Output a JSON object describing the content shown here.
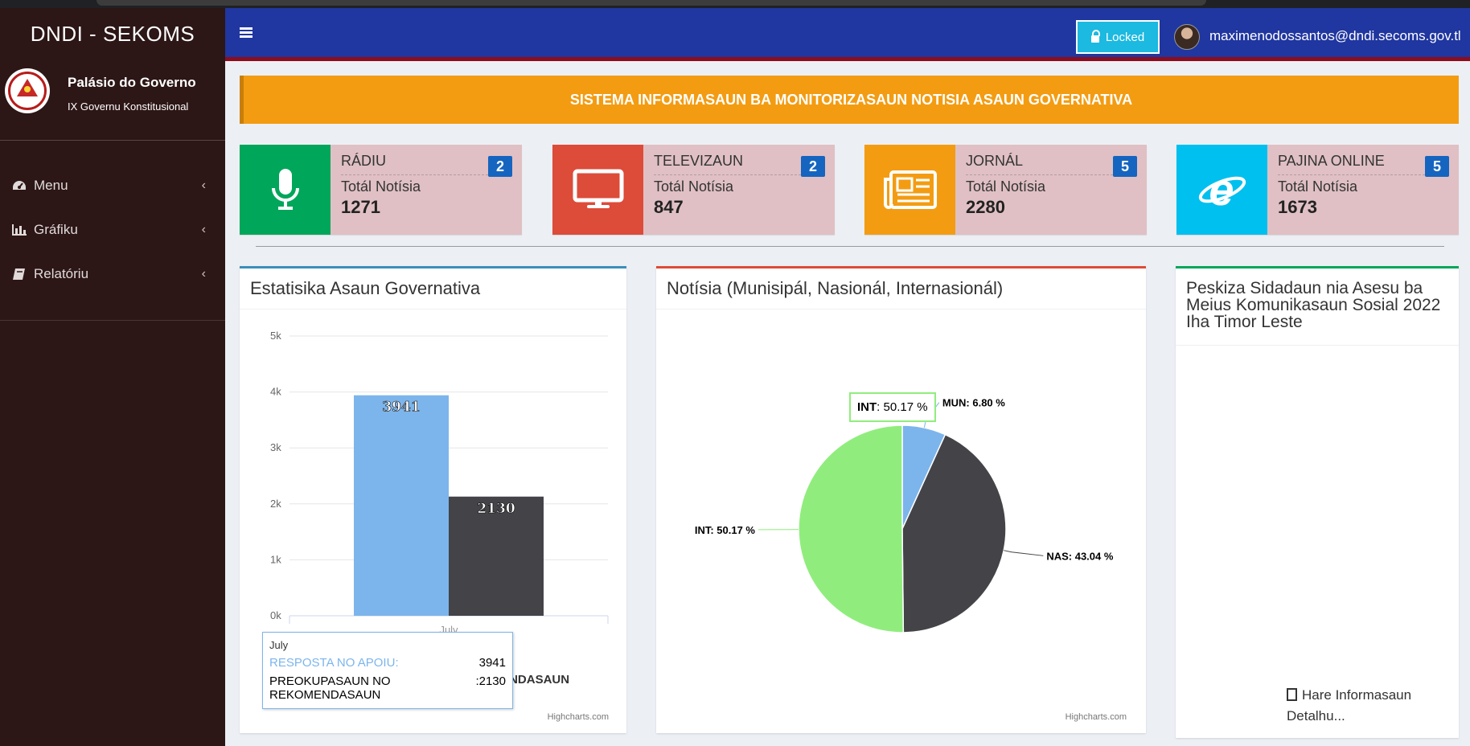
{
  "sidebar": {
    "brand": "DNDI - SEKOMS",
    "org_name": "Palásio do Governo",
    "org_sub": "IX Governu Konstitusional",
    "items": [
      {
        "label": "Menu",
        "icon": "dashboard-icon"
      },
      {
        "label": "Gráfiku",
        "icon": "bar-chart-icon"
      },
      {
        "label": "Relatóriu",
        "icon": "book-icon"
      }
    ]
  },
  "header": {
    "locked_label": "Locked",
    "email": "maximenodossantos@dndi.secoms.gov.tl"
  },
  "banner": "SISTEMA INFORMASAUN BA MONITORIZASAUN NOTISIA ASAUN GOVERNATIVA",
  "info_boxes": [
    {
      "title": "RÁDIU",
      "badge": "2",
      "label": "Totál Notísia",
      "value": "1271",
      "color": "#00a65a",
      "icon": "microphone-icon"
    },
    {
      "title": "TELEVIZAUN",
      "badge": "2",
      "label": "Totál Notísia",
      "value": "847",
      "color": "#dd4b39",
      "icon": "monitor-icon"
    },
    {
      "title": "JORNÁL",
      "badge": "5",
      "label": "Totál Notísia",
      "value": "2280",
      "color": "#f39c12",
      "icon": "newspaper-icon"
    },
    {
      "title": "PAJINA ONLINE",
      "badge": "5",
      "label": "Totál Notísia",
      "value": "1673",
      "color": "#00c0ef",
      "icon": "internet-explorer-icon"
    }
  ],
  "bar_box": {
    "title": "Estatisika Asaun Governativa",
    "credit": "Highcharts.com",
    "tooltip_header": "July"
  },
  "pie_box": {
    "title": "Notísia (Munisipál, Nasionál, Internasionál)",
    "credit": "Highcharts.com",
    "tooltip_label": "INT",
    "tooltip_value": ": 50.17 %"
  },
  "survey_box": {
    "title": "Peskiza Sidadaun nia Asesu ba Meius Komunikasaun Sosial 2022 Iha Timor Leste",
    "link_label": "Hare Informasaun Detalhu..."
  },
  "chart_data": [
    {
      "type": "bar",
      "title": "Estatisika Asaun Governativa",
      "categories": [
        "July"
      ],
      "series": [
        {
          "name": "RESPOSTA NO APOIU",
          "values": [
            3941
          ],
          "color": "#7cb5ec"
        },
        {
          "name": "PREOKUPASAUN NO REKOMENDASAUN",
          "values": [
            2130
          ],
          "color": "#434348"
        }
      ],
      "ylim": [
        0,
        5000
      ],
      "yticks": [
        "0k",
        "1k",
        "2k",
        "3k",
        "4k",
        "5k"
      ],
      "grid": true
    },
    {
      "type": "pie",
      "title": "Notísia (Munisipál, Nasionál, Internasionál)",
      "slices": [
        {
          "label": "MUN",
          "value": 6.8,
          "display": "MUN: 6.80 %",
          "color": "#7cb5ec"
        },
        {
          "label": "NAS",
          "value": 43.04,
          "display": "NAS: 43.04 %",
          "color": "#434348"
        },
        {
          "label": "INT",
          "value": 50.17,
          "display": "INT: 50.17 %",
          "color": "#90ed7d"
        }
      ]
    }
  ]
}
